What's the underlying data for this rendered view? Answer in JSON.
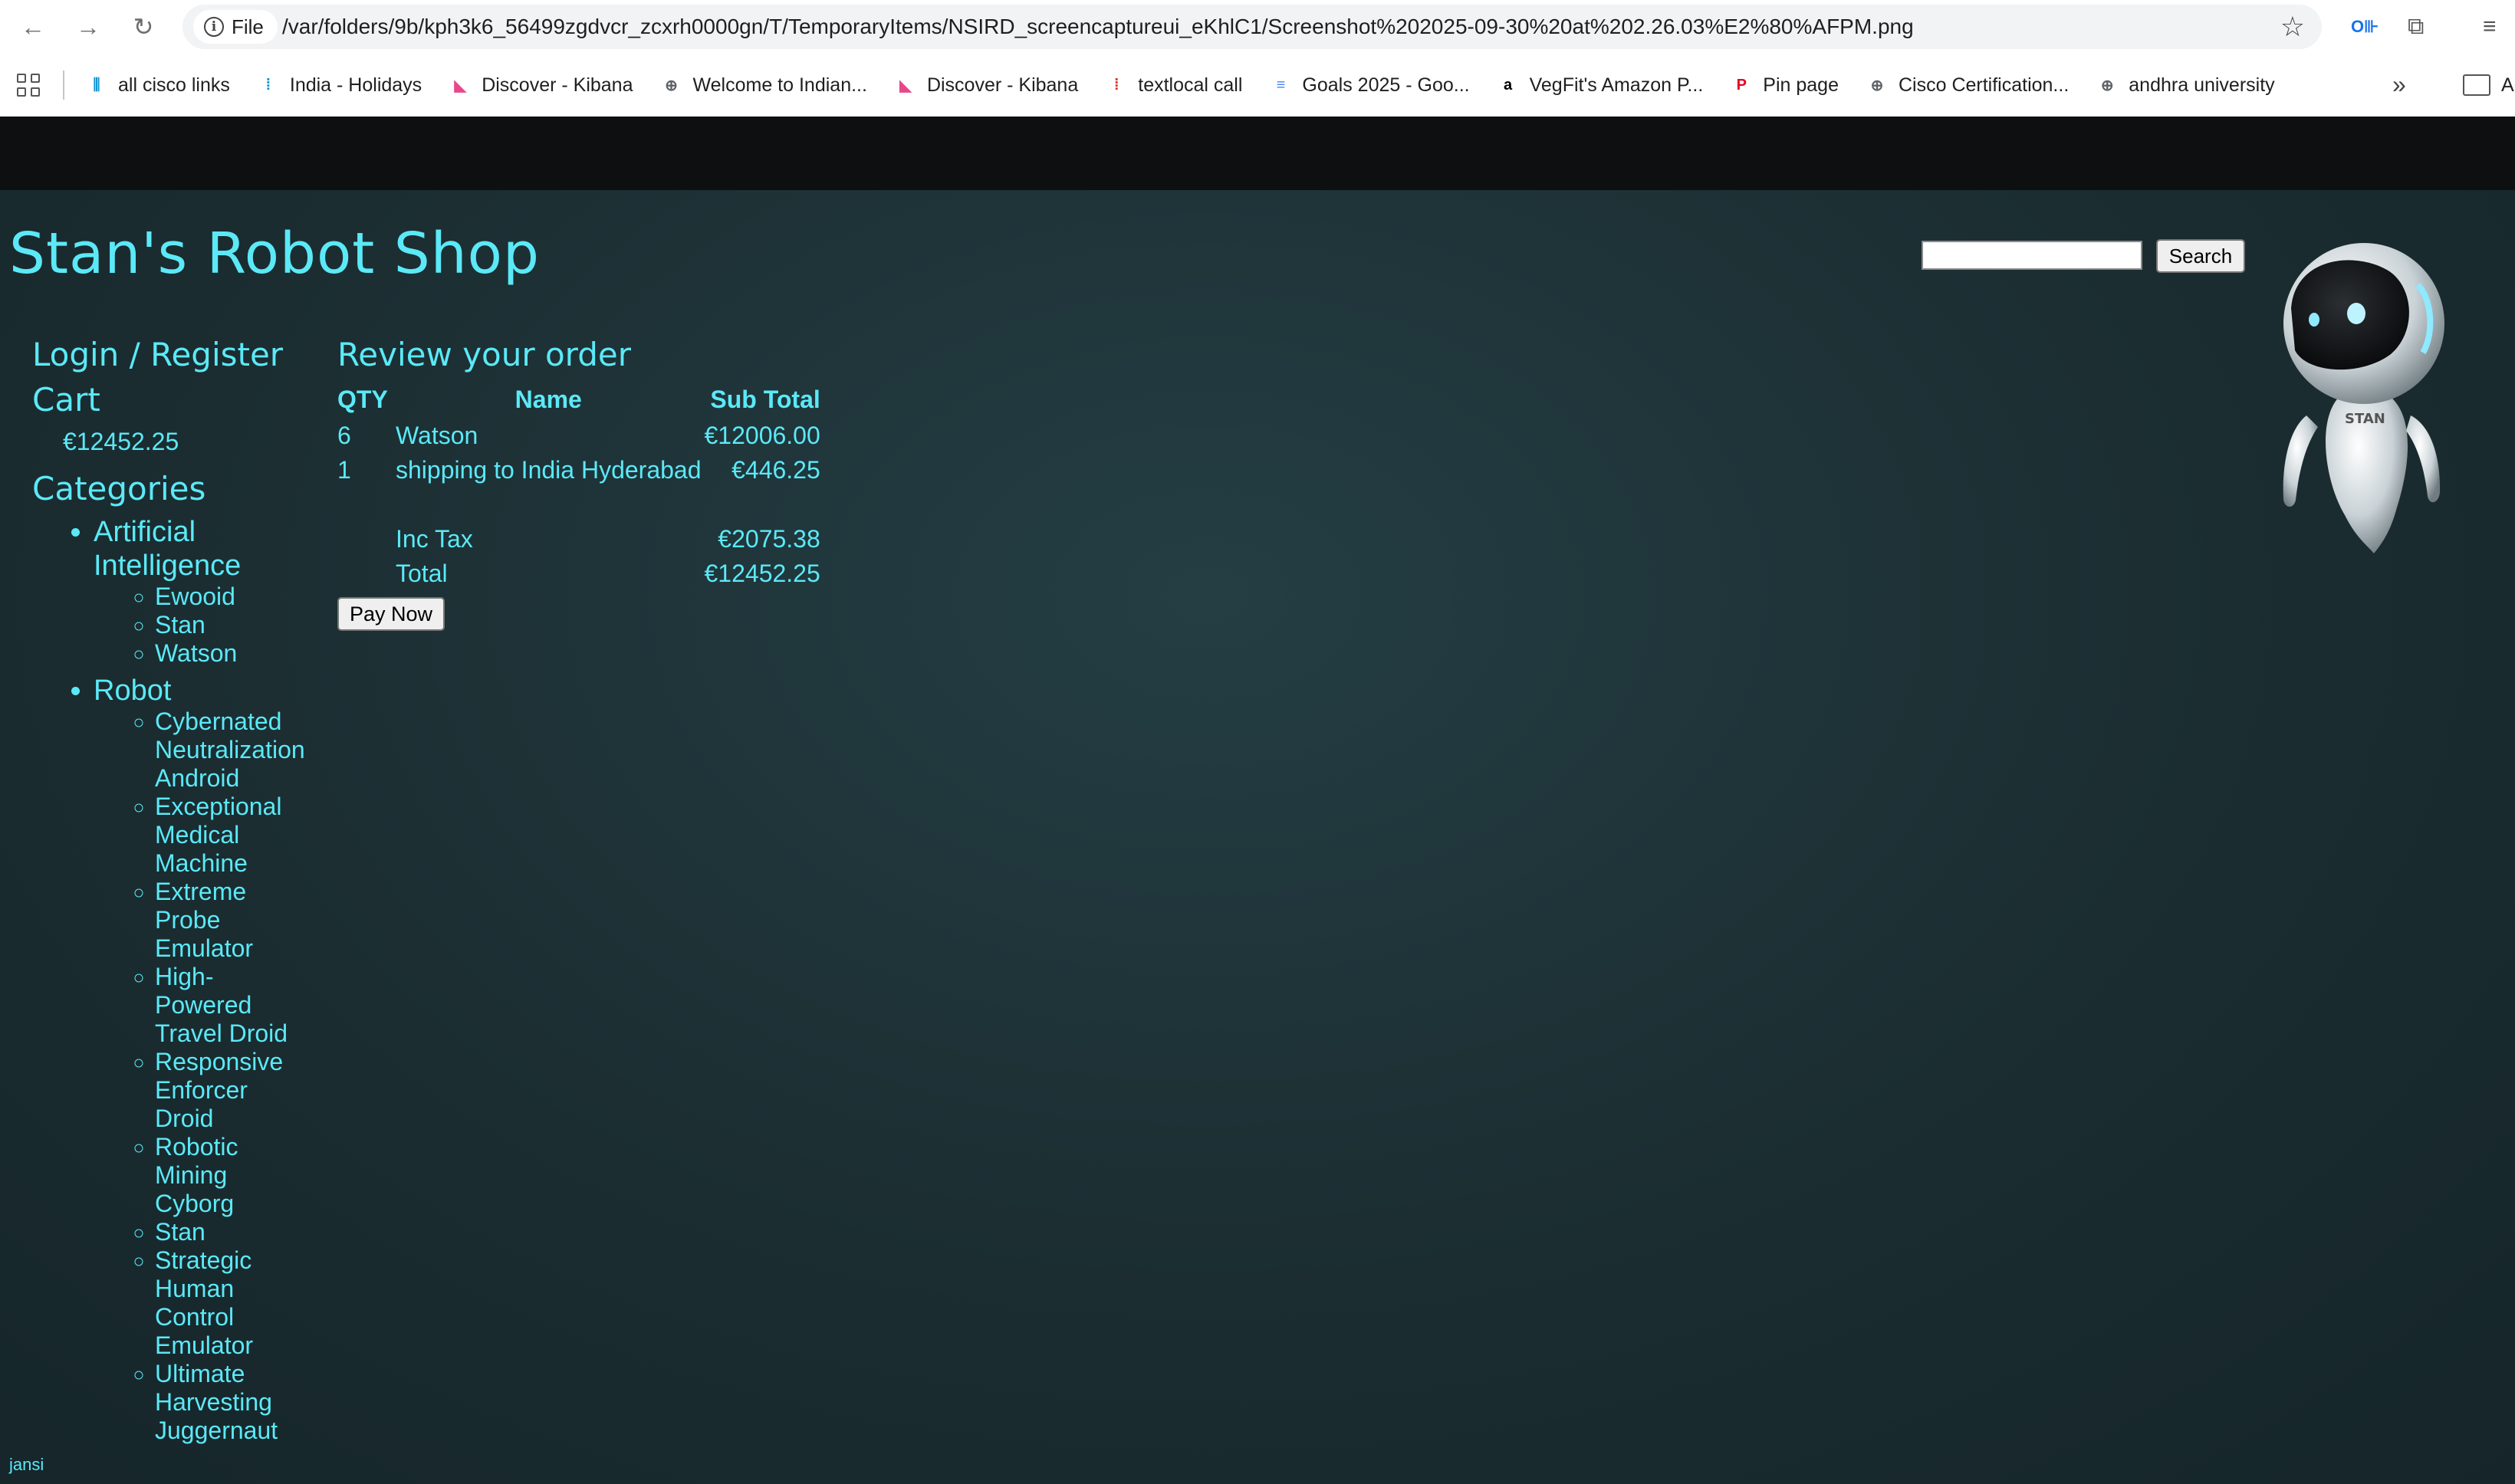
{
  "browser": {
    "scheme_label": "File",
    "url": "/var/folders/9b/kph3k6_56499zgdvcr_zcxrh0000gn/T/TemporaryItems/NSIRD_screencaptureui_eKhlC1/Screenshot%202025-09-30%20at%202.26.03%E2%80%AFPM.png",
    "bookmarks": [
      {
        "label": "all cisco links",
        "icon": "bar-chart-icon",
        "color": "#0d94d2",
        "glyph": "⫼"
      },
      {
        "label": "India - Holidays",
        "icon": "cisco-icon",
        "color": "#0d94d2",
        "glyph": "⁞"
      },
      {
        "label": "Discover - Kibana",
        "icon": "kibana-icon",
        "color": "#e8488b",
        "glyph": "◣"
      },
      {
        "label": "Welcome to Indian...",
        "icon": "globe-icon",
        "color": "#5f6368",
        "glyph": "⊕"
      },
      {
        "label": "Discover - Kibana",
        "icon": "kibana-icon",
        "color": "#e8488b",
        "glyph": "◣"
      },
      {
        "label": "textlocal call",
        "icon": "cisco-icon",
        "color": "#d93025",
        "glyph": "⁞"
      },
      {
        "label": "Goals 2025 - Goo...",
        "icon": "google-docs-icon",
        "color": "#4285f4",
        "glyph": "≡"
      },
      {
        "label": "VegFit's Amazon P...",
        "icon": "amazon-icon",
        "color": "#000000",
        "glyph": "a"
      },
      {
        "label": "Pin page",
        "icon": "pinterest-icon",
        "color": "#e60023",
        "glyph": "P"
      },
      {
        "label": "Cisco Certification...",
        "icon": "globe-icon",
        "color": "#5f6368",
        "glyph": "⊕"
      },
      {
        "label": "andhra university",
        "icon": "globe-icon",
        "color": "#5f6368",
        "glyph": "⊕"
      }
    ],
    "more_glyph": "»",
    "folder_label": "A"
  },
  "shop": {
    "title": "Stan's Robot Shop",
    "search_button": "Search",
    "search_value": ""
  },
  "sidebar": {
    "login_label": "Login / Register",
    "cart_label": "Cart",
    "cart_total": "€12452.25",
    "categories_label": "Categories",
    "categories": [
      {
        "name": "Artificial Intelligence",
        "items": [
          "Ewooid",
          "Stan",
          "Watson"
        ]
      },
      {
        "name": "Robot",
        "items": [
          "Cybernated Neutralization Android",
          "Exceptional Medical Machine",
          "Extreme Probe Emulator",
          "High-Powered Travel Droid",
          "Responsive Enforcer Droid",
          "Robotic Mining Cyborg",
          "Stan",
          "Strategic Human Control Emulator",
          "Ultimate Harvesting Juggernaut"
        ]
      }
    ]
  },
  "order": {
    "heading": "Review your order",
    "columns": {
      "qty": "QTY",
      "name": "Name",
      "subtotal": "Sub Total"
    },
    "rows": [
      {
        "qty": "6",
        "name": "Watson",
        "subtotal": "€12006.00"
      },
      {
        "qty": "1",
        "name": "shipping to India Hyderabad",
        "subtotal": "€446.25"
      }
    ],
    "tax_label": "Inc Tax",
    "tax_value": "€2075.38",
    "total_label": "Total",
    "total_value": "€12452.25",
    "pay_button": "Pay Now"
  },
  "footer": {
    "user": "jansi"
  },
  "colors": {
    "accent": "#5be9f7",
    "page_bg": "#1c2e32",
    "band": "#0d0f10"
  }
}
